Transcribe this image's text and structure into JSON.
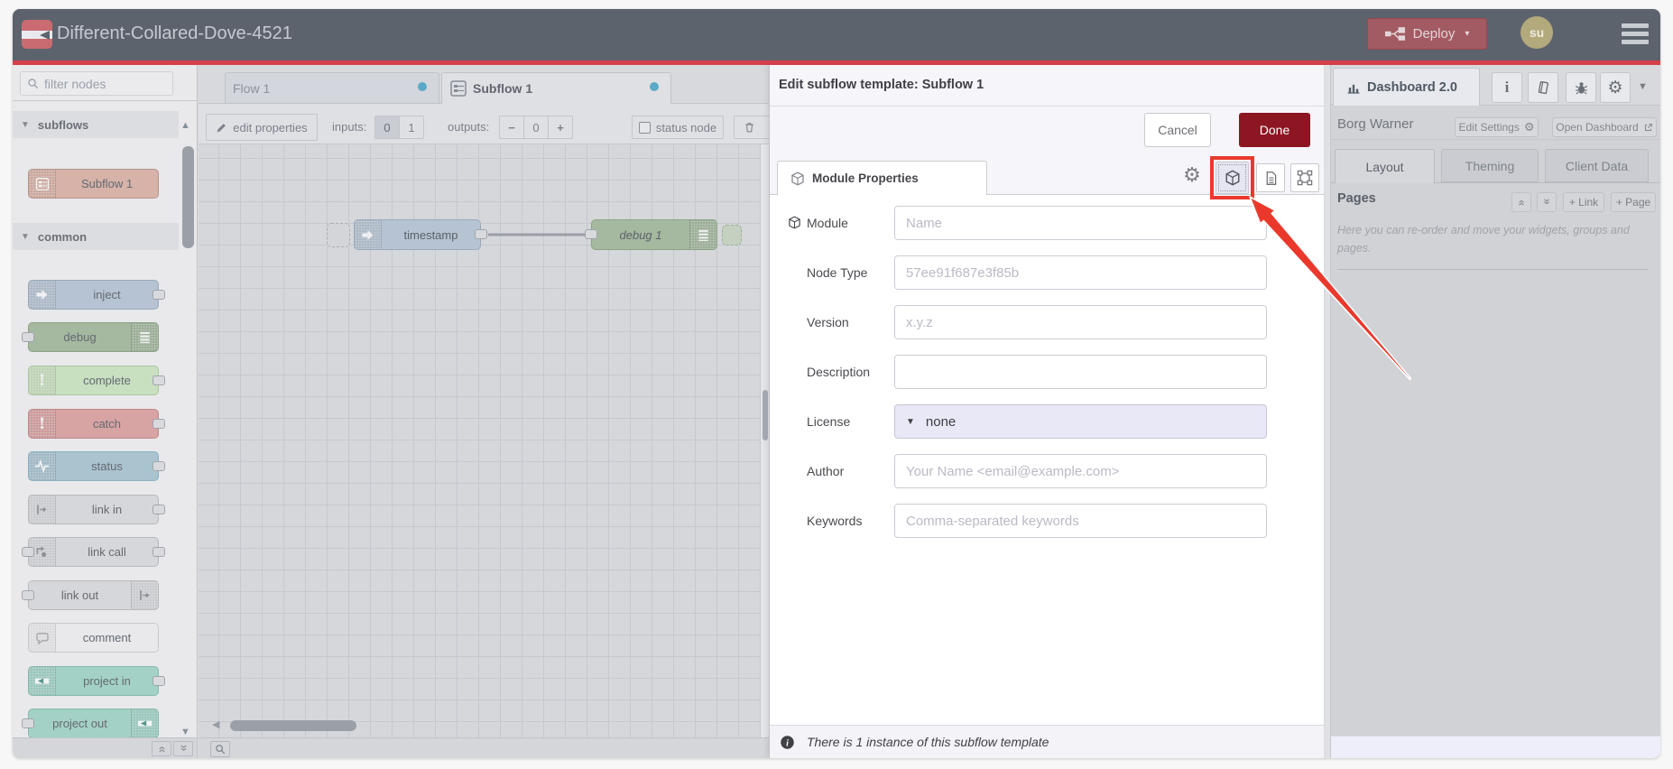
{
  "header": {
    "title": "Different-Collared-Dove-4521",
    "deploy_label": "Deploy",
    "avatar_initials": "su"
  },
  "palette": {
    "filter_placeholder": "filter nodes",
    "sections": [
      {
        "label": "subflows",
        "items": [
          {
            "label": "Subflow 1",
            "kind": "subflow"
          }
        ]
      },
      {
        "label": "common",
        "items": [
          {
            "label": "inject",
            "kind": "inject"
          },
          {
            "label": "debug",
            "kind": "debug"
          },
          {
            "label": "complete",
            "kind": "complete"
          },
          {
            "label": "catch",
            "kind": "catch"
          },
          {
            "label": "status",
            "kind": "status"
          },
          {
            "label": "link in",
            "kind": "link-in"
          },
          {
            "label": "link call",
            "kind": "link-call"
          },
          {
            "label": "link out",
            "kind": "link-out"
          },
          {
            "label": "comment",
            "kind": "comment"
          },
          {
            "label": "project in",
            "kind": "project-in"
          },
          {
            "label": "project out",
            "kind": "project-out"
          }
        ]
      }
    ]
  },
  "node_colors": {
    "subflow": {
      "bg": "#d6b2a8",
      "border": "#b6968c"
    },
    "inject": {
      "bg": "#b5c3d2",
      "border": "#99aabb"
    },
    "debug": {
      "bg": "#a5b8a0",
      "border": "#8ba285"
    },
    "complete": {
      "bg": "#c8dfc0",
      "border": "#aac6a0"
    },
    "catch": {
      "bg": "#d7a3a3",
      "border": "#be8989"
    },
    "status": {
      "bg": "#a9c3cf",
      "border": "#8db1c2"
    },
    "link-in": {
      "bg": "#d6d7da",
      "border": "#b8b9bd"
    },
    "link-call": {
      "bg": "#d6d7da",
      "border": "#b8b9bd"
    },
    "link-out": {
      "bg": "#d6d7da",
      "border": "#b8b9bd"
    },
    "comment": {
      "bg": "#e9e9ec",
      "border": "#c8c9cc"
    },
    "project-in": {
      "bg": "#a3d1c6",
      "border": "#85baad"
    },
    "project-out": {
      "bg": "#a3d1c6",
      "border": "#85baad"
    }
  },
  "workspace": {
    "tabs": [
      {
        "label": "Flow 1",
        "active": false,
        "dirty": true
      },
      {
        "label": "Subflow 1",
        "active": true,
        "dirty": true
      }
    ],
    "toolbar": {
      "edit_properties": "edit properties",
      "inputs_label": "inputs:",
      "input_options": [
        "0",
        "1"
      ],
      "input_selected": "0",
      "outputs_label": "outputs:",
      "outputs_value": "0",
      "status_node": "status node"
    },
    "nodes": [
      {
        "label": "timestamp",
        "kind": "inject"
      },
      {
        "label": "debug 1",
        "kind": "debug"
      }
    ]
  },
  "dialog": {
    "title": "Edit subflow template: Subflow 1",
    "cancel": "Cancel",
    "done": "Done",
    "tab": "Module Properties",
    "fields": [
      {
        "label": "Module",
        "placeholder": "Name",
        "icon": "cube"
      },
      {
        "label": "Node Type",
        "placeholder": "57ee91f687e3f85b"
      },
      {
        "label": "Version",
        "placeholder": "x.y.z"
      },
      {
        "label": "Description",
        "placeholder": ""
      },
      {
        "label": "License",
        "value": "none",
        "type": "select"
      },
      {
        "label": "Author",
        "placeholder": "Your Name <email@example.com>"
      },
      {
        "label": "Keywords",
        "placeholder": "Comma-separated keywords"
      }
    ],
    "footer": "There is 1 instance of this subflow template"
  },
  "sidebar": {
    "tab": "Dashboard 2.0",
    "project": "Borg Warner",
    "edit_settings": "Edit Settings",
    "open_dashboard": "Open Dashboard",
    "tabs": [
      "Layout",
      "Theming",
      "Client Data"
    ],
    "active_tab": "Layout",
    "pages_label": "Pages",
    "link_button": "+ Link",
    "page_button": "+ Page",
    "help_text": "Here you can re-order and move your widgets, groups and pages."
  },
  "colors": {
    "done_red": "#8C1622",
    "annotation_red": "#ea392c",
    "header_bg": "#5d636d",
    "unsaved_dot": "#5ba9c7"
  }
}
